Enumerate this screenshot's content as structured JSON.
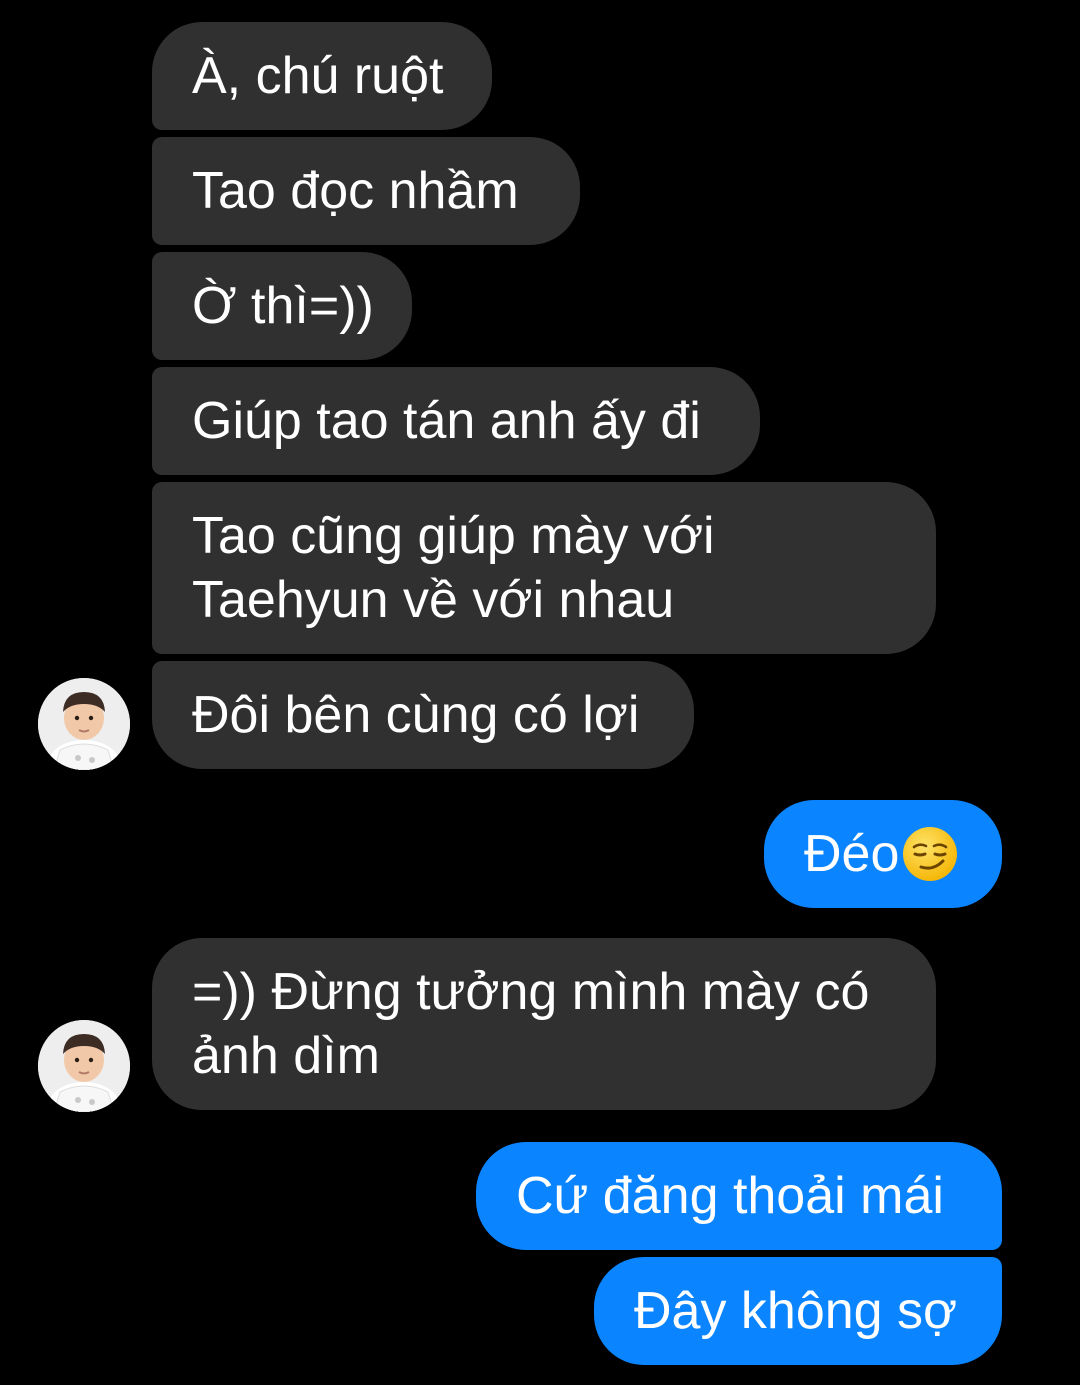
{
  "messages": [
    {
      "id": "m1",
      "side": "incoming",
      "text": "À, chú ruột"
    },
    {
      "id": "m2",
      "side": "incoming",
      "text": "Tao đọc nhầm"
    },
    {
      "id": "m3",
      "side": "incoming",
      "text": "Ờ thì=))"
    },
    {
      "id": "m4",
      "side": "incoming",
      "text": "Giúp tao tán anh ấy đi"
    },
    {
      "id": "m5",
      "side": "incoming",
      "lines": [
        "Tao cũng giúp mày với",
        "Taehyun về với nhau"
      ]
    },
    {
      "id": "m6",
      "side": "incoming",
      "text": "Đôi bên cùng có lợi"
    },
    {
      "id": "m7",
      "side": "outgoing",
      "text": "Đéo",
      "emoji": "smirking-face-emoji"
    },
    {
      "id": "m8",
      "side": "incoming",
      "lines": [
        "=)) Đừng tưởng mình mày có",
        "ảnh dìm"
      ]
    },
    {
      "id": "m9",
      "side": "outgoing",
      "text": "Cứ đăng thoải mái"
    },
    {
      "id": "m10",
      "side": "outgoing",
      "text": "Đây không sợ"
    }
  ],
  "colors": {
    "background": "#000000",
    "incoming_bubble": "#303030",
    "outgoing_bubble": "#0a84ff",
    "text": "#ffffff"
  },
  "icons": [
    "contact-avatar",
    "smirking-face-emoji"
  ]
}
